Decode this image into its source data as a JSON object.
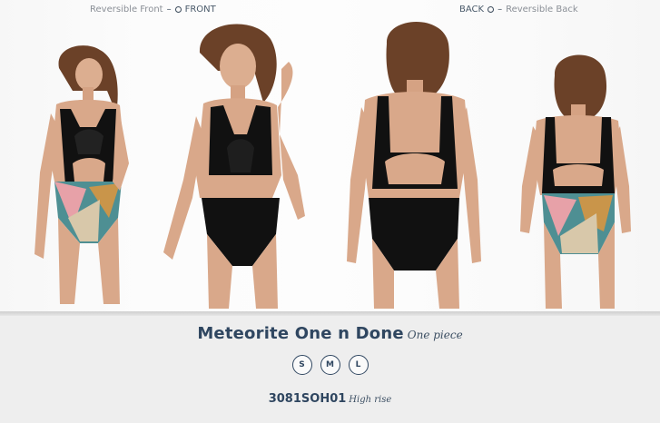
{
  "labels": {
    "front_prefix": "Reversible Front",
    "front_main": "FRONT",
    "back_main": "BACK",
    "back_suffix": "Reversible Back"
  },
  "product": {
    "name": "Meteorite One n Done",
    "category": "One piece",
    "sizes": [
      "S",
      "M",
      "L"
    ],
    "sku": "3081SOH01",
    "rise": "High rise"
  },
  "colors": {
    "title": "#2f4660",
    "swimsuit": "#111111",
    "skin": "#d9a88a",
    "hair": "#6b4128",
    "print_pink": "#e7a1a8",
    "print_teal": "#4e8f93",
    "print_ochre": "#c9954a",
    "print_beige": "#d8c8aa"
  },
  "icons": [
    "front-marker-icon",
    "back-marker-icon"
  ]
}
